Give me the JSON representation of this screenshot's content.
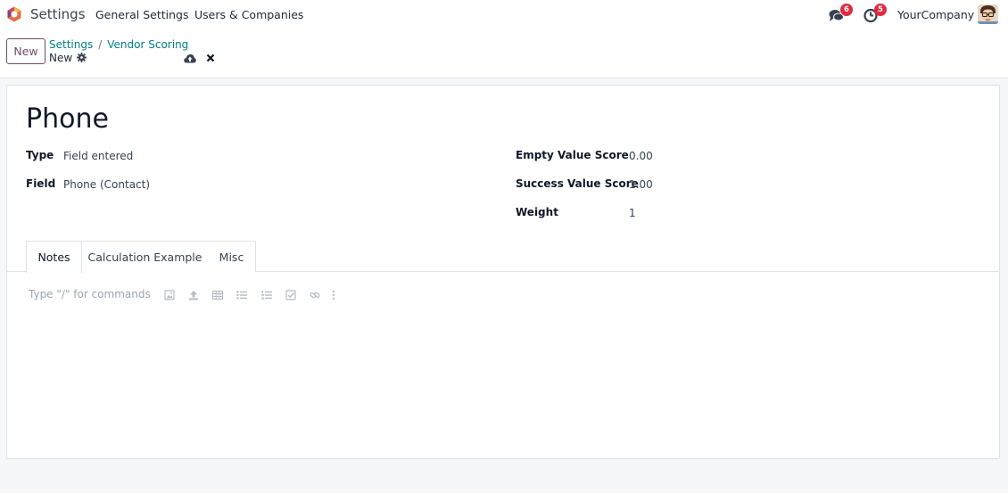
{
  "navbar": {
    "app_title": "Settings",
    "menu": [
      "General Settings",
      "Users & Companies"
    ],
    "messages_badge": "6",
    "activities_badge": "5",
    "company": "YourCompany"
  },
  "control": {
    "new_label": "New",
    "breadcrumb": [
      "Settings",
      "Vendor Scoring"
    ],
    "breadcrumb_sep": "/",
    "record_name": "New"
  },
  "form": {
    "title": "Phone",
    "left": [
      {
        "label": "Type",
        "value": "Field entered"
      },
      {
        "label": "Field",
        "value": "Phone (Contact)"
      }
    ],
    "right": [
      {
        "label": "Empty Value Score",
        "value": "0.00"
      },
      {
        "label": "Success Value Score",
        "value": "1.00"
      },
      {
        "label": "Weight",
        "value": "1"
      }
    ],
    "tabs": [
      "Notes",
      "Calculation Example",
      "Misc"
    ],
    "active_tab": "Notes",
    "editor_placeholder": "Type \"/\" for commands"
  },
  "colors": {
    "accent": "#714b67",
    "link": "#017e84",
    "badge": "#e0293e"
  },
  "icons": [
    "app-logo",
    "messages-icon",
    "activities-icon",
    "gear-icon",
    "save-cloud-icon",
    "discard-icon",
    "image-icon",
    "upload-icon",
    "table-icon",
    "bullet-list-icon",
    "numbered-list-icon",
    "checklist-icon",
    "link-icon",
    "more-icon"
  ]
}
